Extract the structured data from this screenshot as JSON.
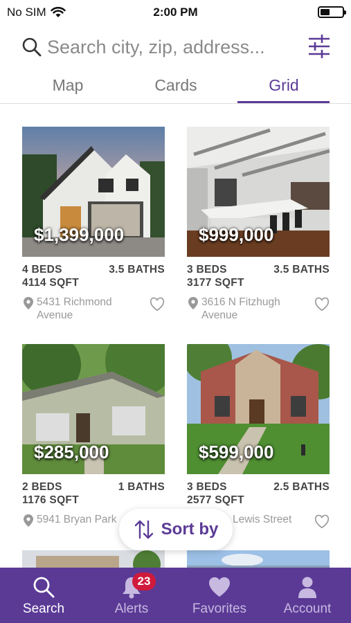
{
  "status_bar": {
    "carrier": "No SIM",
    "time": "2:00 PM"
  },
  "search": {
    "placeholder": "Search city, zip, address..."
  },
  "tabs": [
    {
      "label": "Map",
      "active": false
    },
    {
      "label": "Cards",
      "active": false
    },
    {
      "label": "Grid",
      "active": true
    }
  ],
  "listings": [
    {
      "price": "$1,399,000",
      "beds": "4 BEDS",
      "baths": "3.5 BATHS",
      "sqft": "4114 SQFT",
      "address": "5431 Richmond Avenue"
    },
    {
      "price": "$999,000",
      "beds": "3 BEDS",
      "baths": "3.5 BATHS",
      "sqft": "3177 SQFT",
      "address": "3616 N Fitzhugh Avenue"
    },
    {
      "price": "$285,000",
      "beds": "2 BEDS",
      "baths": "1 BATHS",
      "sqft": "1176 SQFT",
      "address": "5941 Bryan Park"
    },
    {
      "price": "$599,000",
      "beds": "3 BEDS",
      "baths": "2.5 BATHS",
      "sqft": "2577 SQFT",
      "address": "Lewis Street"
    }
  ],
  "sort": {
    "label": "Sort by"
  },
  "tabbar": {
    "items": [
      {
        "label": "Search",
        "icon": "search-icon",
        "active": true
      },
      {
        "label": "Alerts",
        "icon": "bell-icon",
        "badge": "23"
      },
      {
        "label": "Favorites",
        "icon": "heart-icon"
      },
      {
        "label": "Account",
        "icon": "person-icon"
      }
    ]
  },
  "colors": {
    "accent": "#5b3a96",
    "badge": "#d01a3c",
    "tabbar": "#5b3a96"
  }
}
